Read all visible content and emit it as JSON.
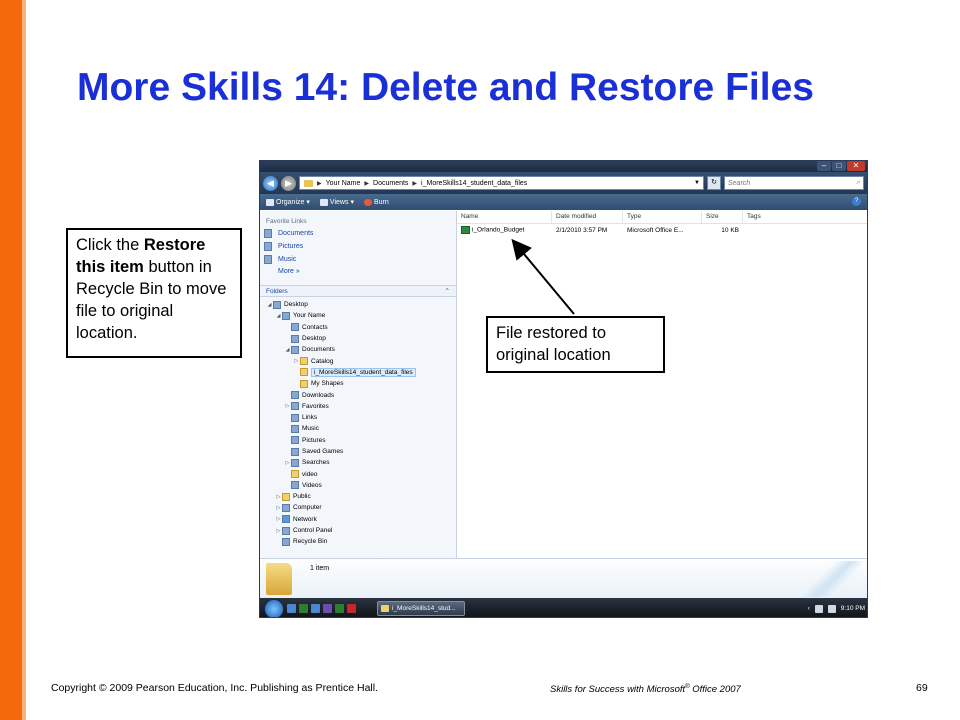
{
  "slide": {
    "title": "More Skills 14: Delete and Restore Files",
    "callout_left": {
      "pre": "Click the ",
      "bold": "Restore this item",
      "post": " button in Recycle Bin to move file to original location."
    },
    "callout_right": "File restored to original location",
    "footer_left": "Copyright © 2009 Pearson Education, Inc. Publishing as Prentice Hall.",
    "footer_mid_pre": "Skills for Success with Microsoft",
    "footer_mid_reg": "®",
    "footer_mid_post": " Office 2007",
    "page_number": "69"
  },
  "colors": {
    "title": "#1a2fd6",
    "accent_bar": "#f46a0b"
  },
  "explorer": {
    "window_buttons": [
      "–",
      "□",
      "✕"
    ],
    "address_path": [
      "Your Name",
      "Documents",
      "i_MoreSkills14_student_data_files"
    ],
    "search_placeholder": "Search",
    "toolbar": {
      "organize": "Organize",
      "views": "Views",
      "burn": "Burn"
    },
    "nav": {
      "favorites_header": "Favorite Links",
      "favorites": [
        "Documents",
        "Pictures",
        "Music"
      ],
      "more": "More",
      "folders_header": "Folders",
      "tree": [
        {
          "label": "Desktop",
          "level": 0,
          "toggle": "◢",
          "icon": "desktop-icon"
        },
        {
          "label": "Your Name",
          "level": 1,
          "toggle": "◢",
          "icon": "user-folder-icon"
        },
        {
          "label": "Contacts",
          "level": 2,
          "toggle": "",
          "icon": "contacts-icon"
        },
        {
          "label": "Desktop",
          "level": 2,
          "toggle": "",
          "icon": "desktop-icon"
        },
        {
          "label": "Documents",
          "level": 2,
          "toggle": "◢",
          "icon": "documents-icon"
        },
        {
          "label": "Catalog",
          "level": 3,
          "toggle": "▷",
          "icon": "folder-icon"
        },
        {
          "label": "i_MoreSkills14_student_data_files",
          "level": 3,
          "toggle": "",
          "icon": "folder-icon",
          "selected": true
        },
        {
          "label": "My Shapes",
          "level": 3,
          "toggle": "",
          "icon": "folder-icon"
        },
        {
          "label": "Downloads",
          "level": 2,
          "toggle": "",
          "icon": "downloads-icon"
        },
        {
          "label": "Favorites",
          "level": 2,
          "toggle": "▷",
          "icon": "favorites-icon"
        },
        {
          "label": "Links",
          "level": 2,
          "toggle": "",
          "icon": "links-icon"
        },
        {
          "label": "Music",
          "level": 2,
          "toggle": "",
          "icon": "music-icon"
        },
        {
          "label": "Pictures",
          "level": 2,
          "toggle": "",
          "icon": "pictures-icon"
        },
        {
          "label": "Saved Games",
          "level": 2,
          "toggle": "",
          "icon": "saved-games-icon"
        },
        {
          "label": "Searches",
          "level": 2,
          "toggle": "▷",
          "icon": "searches-icon"
        },
        {
          "label": "video",
          "level": 2,
          "toggle": "",
          "icon": "folder-icon"
        },
        {
          "label": "Videos",
          "level": 2,
          "toggle": "",
          "icon": "videos-icon"
        },
        {
          "label": "Public",
          "level": 1,
          "toggle": "▷",
          "icon": "folder-icon"
        },
        {
          "label": "Computer",
          "level": 1,
          "toggle": "▷",
          "icon": "computer-icon"
        },
        {
          "label": "Network",
          "level": 1,
          "toggle": "▷",
          "icon": "network-icon"
        },
        {
          "label": "Control Panel",
          "level": 1,
          "toggle": "▷",
          "icon": "control-panel-icon"
        },
        {
          "label": "Recycle Bin",
          "level": 1,
          "toggle": "",
          "icon": "recycle-bin-icon"
        }
      ]
    },
    "columns": [
      "Name",
      "Date modified",
      "Type",
      "Size",
      "Tags"
    ],
    "files": [
      {
        "name": "i_Orlando_Budget",
        "date": "2/1/2010 3:57 PM",
        "type": "Microsoft Office E...",
        "size": "10 KB"
      }
    ],
    "details": {
      "items_count": "1 item"
    },
    "taskbar": {
      "task_label": "i_MoreSkills14_stud...",
      "time": "9:10 PM"
    }
  }
}
